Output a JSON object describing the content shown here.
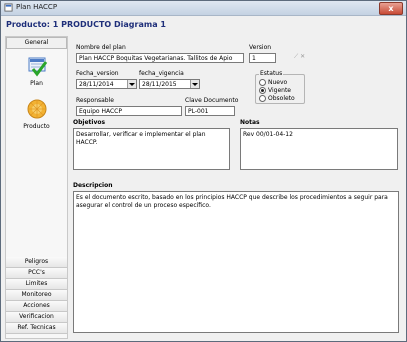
{
  "window": {
    "title": "Plan HACCP",
    "close_label": "x"
  },
  "header": {
    "title": "Producto: 1 PRODUCTO Diagrama 1"
  },
  "sidebar": {
    "active_tab": "General",
    "icons": [
      {
        "label": "Plan",
        "icon": "plan-icon"
      },
      {
        "label": "Producto",
        "icon": "product-icon"
      }
    ],
    "tabs": [
      "Peligros",
      "PCC's",
      "Limites",
      "Monitoreo",
      "Acciones correctivas",
      "Verificacion",
      "Ref. Tecnicas"
    ]
  },
  "form": {
    "nombre_label": "Nombre del plan",
    "nombre_value": "Plan HACCP Boquitas Vegetarianas. Tallitos de Apio",
    "version_label": "Version",
    "version_value": "1",
    "fecha_version_label": "Fecha_version",
    "fecha_version_value": "28/11/2014",
    "fecha_vigencia_label": "fecha_vigencia",
    "fecha_vigencia_value": "28/11/2015",
    "estatus_label": "Estatus",
    "estatus_options": [
      "Nuevo",
      "Vigente",
      "Obsoleto"
    ],
    "estatus_selected": "Vigente",
    "responsable_label": "Responsable",
    "responsable_value": "Equipo HACCP",
    "clave_label": "Clave Documento",
    "clave_value": "PL-001",
    "objetivos_label": "Objetivos",
    "objetivos_value": "Desarrollar, verificar e implementar el plan HACCP.",
    "notas_label": "Notas",
    "notas_value": "Rev 00/01-04-12",
    "descripcion_label": "Descripcion",
    "descripcion_value": "Es el documento escrito, basado en los principios HACCP que describe los procedimientos a seguir para asegurar el control de un proceso específico."
  }
}
